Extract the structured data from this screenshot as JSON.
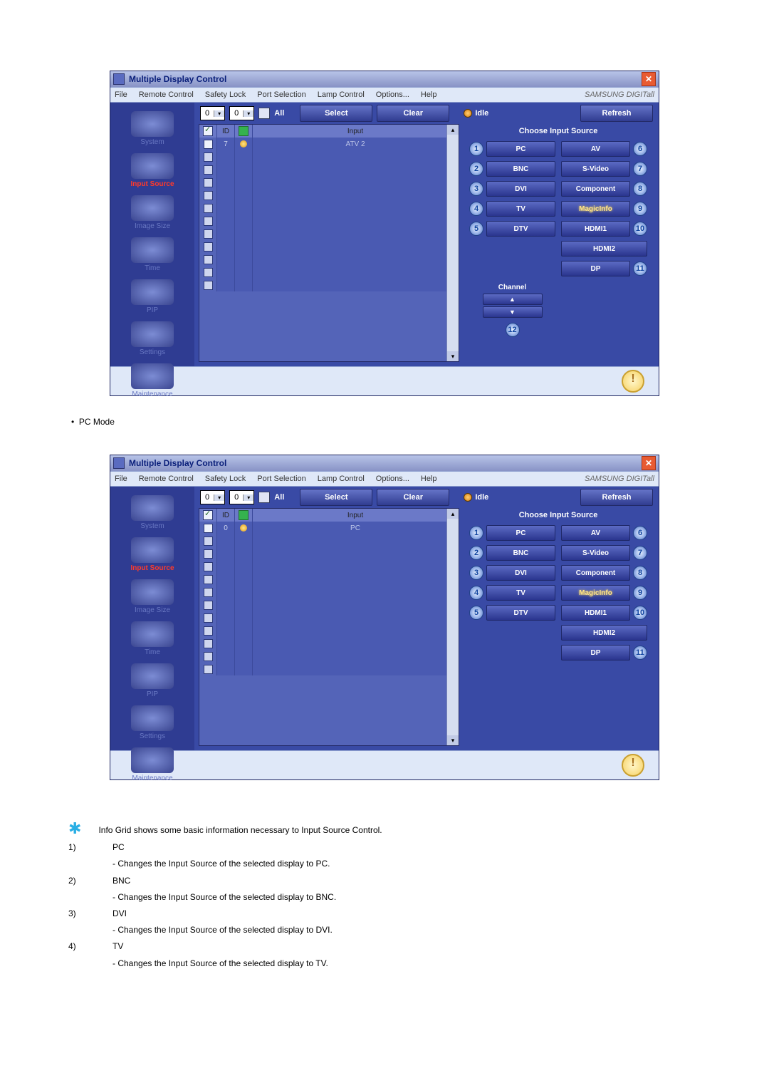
{
  "bullet_pc_mode": "PC Mode",
  "window": {
    "title": "Multiple Display Control",
    "menus": [
      "File",
      "Remote Control",
      "Safety Lock",
      "Port Selection",
      "Lamp Control",
      "Options...",
      "Help"
    ],
    "brand": "SAMSUNG DIGITall",
    "topbar": {
      "spin1": "0",
      "spin2": "0",
      "all": "All",
      "select_btn": "Select",
      "clear_btn": "Clear",
      "idle": "Idle",
      "refresh_btn": "Refresh"
    },
    "sidebar": {
      "items": [
        {
          "label": "System"
        },
        {
          "label": "Input Source",
          "active": true
        },
        {
          "label": "Image Size"
        },
        {
          "label": "Time"
        },
        {
          "label": "PIP"
        },
        {
          "label": "Settings"
        },
        {
          "label": "Maintenance"
        }
      ]
    },
    "grid": {
      "headers": {
        "id": "ID",
        "input": "Input"
      }
    },
    "panel": {
      "title": "Choose Input Source",
      "channel_label": "Channel",
      "sources_left": [
        {
          "n": "1",
          "label": "PC"
        },
        {
          "n": "2",
          "label": "BNC"
        },
        {
          "n": "3",
          "label": "DVI"
        },
        {
          "n": "4",
          "label": "TV"
        },
        {
          "n": "5",
          "label": "DTV"
        }
      ],
      "sources_right": [
        {
          "n": "6",
          "label": "AV"
        },
        {
          "n": "7",
          "label": "S-Video"
        },
        {
          "n": "8",
          "label": "Component"
        },
        {
          "n": "9",
          "label": "MagicInfo"
        },
        {
          "n": "10",
          "label": "HDMI1"
        },
        {
          "n": "",
          "label": "HDMI2"
        },
        {
          "n": "11",
          "label": "DP"
        }
      ],
      "channel_num": "12"
    }
  },
  "screens": [
    {
      "first_row": {
        "id": "7",
        "input": "ATV 2",
        "status": "on"
      },
      "show_channel": true
    },
    {
      "first_row": {
        "id": "0",
        "input": "PC",
        "status": "on"
      },
      "show_channel": false
    }
  ],
  "notes": {
    "info_line": "Info Grid shows some basic information necessary to Input Source Control.",
    "items": [
      {
        "num": "1)",
        "name": "PC",
        "desc": "- Changes the Input Source of the selected display to PC."
      },
      {
        "num": "2)",
        "name": "BNC",
        "desc": "- Changes the Input Source of the selected display to BNC."
      },
      {
        "num": "3)",
        "name": "DVI",
        "desc": "- Changes the Input Source of the selected display to DVI."
      },
      {
        "num": "4)",
        "name": "TV",
        "desc": "- Changes the Input Source of the selected display to TV."
      }
    ]
  }
}
